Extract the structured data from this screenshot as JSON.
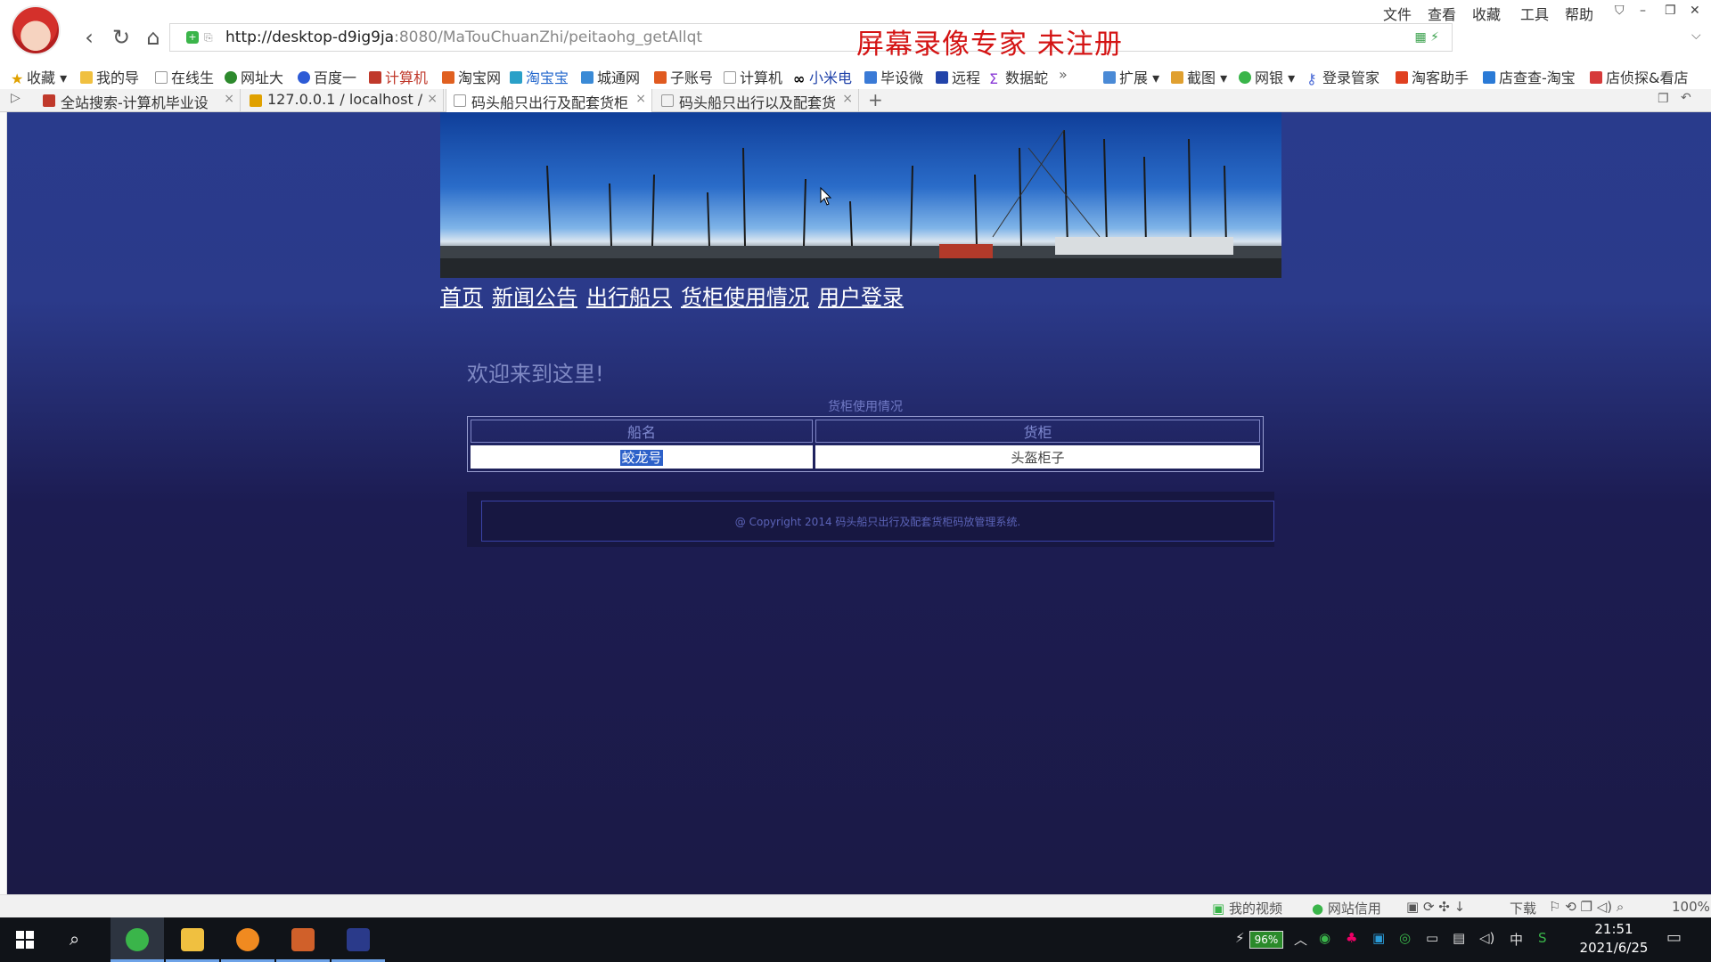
{
  "browser": {
    "url_host": "http://desktop-d9ig9ja",
    "url_path": ":8080/MaTouChuanZhi/peitaohg_getAllqt",
    "recorder_watermark": "屏幕录像专家  未注册",
    "menu": [
      "文件",
      "查看",
      "收藏",
      "工具",
      "帮助"
    ],
    "bookmarks": [
      "收藏",
      "我的导",
      "在线生",
      "网址大",
      "百度一",
      "计算机",
      "淘宝网",
      "淘宝宝",
      "城通网",
      "子账号",
      "计算机",
      "小米电",
      "毕设微",
      "远程",
      "数据蛇",
      "扩展",
      "截图",
      "网银",
      "登录管家",
      "淘客助手",
      "店查查-淘宝",
      "店侦探&看店"
    ],
    "tabs": [
      {
        "title": "全站搜索-计算机毕业设",
        "icon_color": "#c0392b"
      },
      {
        "title": "127.0.0.1 / localhost / ",
        "icon_color": "#e0a100"
      },
      {
        "title": "码头船只出行及配套货柜",
        "icon_color": "#ffffff"
      },
      {
        "title": "码头船只出行以及配套货",
        "icon_color": "#ffffff"
      }
    ],
    "active_tab_index": 2
  },
  "site": {
    "nav": [
      "首页",
      "新闻公告",
      "出行船只",
      "货柜使用情况",
      "用户登录"
    ],
    "welcome": "欢迎来到这里!",
    "table_caption": "货柜使用情况",
    "table": {
      "headers": [
        "船名",
        "货柜"
      ],
      "rows": [
        [
          "蛟龙号",
          "头盔柜子"
        ]
      ]
    },
    "footer": "@ Copyright 2014 码头船只出行及配套货柜码放管理系统."
  },
  "statusbar": {
    "items": [
      "我的视频",
      "网站信用",
      "下载"
    ],
    "zoom": "100%"
  },
  "taskbar": {
    "battery": "96%",
    "ime": "中",
    "time": "21:51",
    "date": "2021/6/25"
  }
}
